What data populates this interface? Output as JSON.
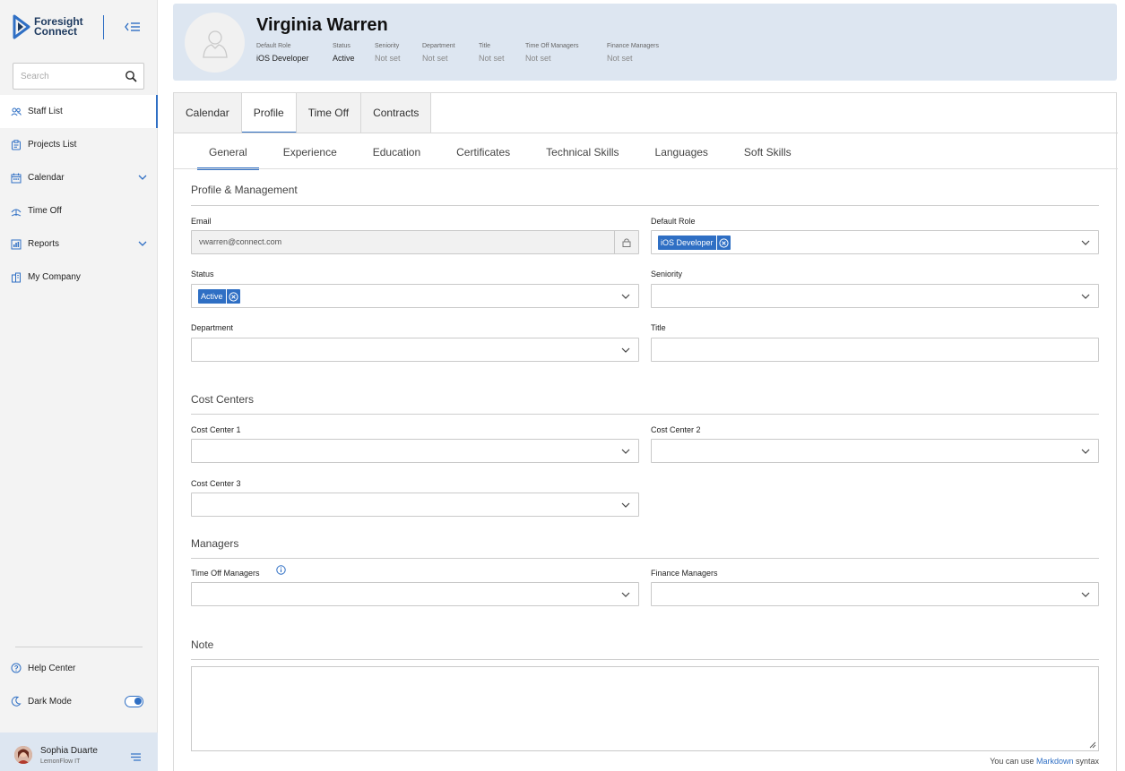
{
  "app": {
    "logo_line1": "Foresight",
    "logo_line2": "Connect",
    "brand_color": "#2f6fc4"
  },
  "search": {
    "placeholder": "Search"
  },
  "sidebar": {
    "items": [
      {
        "label": "Staff List",
        "icon": "people-icon",
        "active": true
      },
      {
        "label": "Projects List",
        "icon": "clipboard-icon"
      },
      {
        "label": "Calendar",
        "icon": "calendar-icon",
        "expandable": true
      },
      {
        "label": "Time Off",
        "icon": "timeoff-icon"
      },
      {
        "label": "Reports",
        "icon": "report-icon",
        "expandable": true
      },
      {
        "label": "My Company",
        "icon": "building-icon"
      }
    ],
    "help": "Help Center",
    "dark_mode": "Dark Mode",
    "dark_mode_on": true
  },
  "user": {
    "name": "Sophia Duarte",
    "org": "LemonFlow IT"
  },
  "profile": {
    "name": "Virginia Warren",
    "meta": [
      {
        "label": "Default Role",
        "value": "iOS Developer"
      },
      {
        "label": "Status",
        "value": "Active"
      },
      {
        "label": "Seniority",
        "value": "Not set"
      },
      {
        "label": "Department",
        "value": "Not set"
      },
      {
        "label": "Title",
        "value": "Not set"
      },
      {
        "label": "Time Off Managers",
        "value": "Not set"
      },
      {
        "label": "Finance Managers",
        "value": "Not set"
      }
    ]
  },
  "tabs": [
    "Calendar",
    "Profile",
    "Time Off",
    "Contracts"
  ],
  "subtabs": [
    "General",
    "Experience",
    "Education",
    "Certificates",
    "Technical Skills",
    "Languages",
    "Soft Skills"
  ],
  "form": {
    "section_profile": "Profile & Management",
    "email_label": "Email",
    "email_value": "vwarren@connect.com",
    "default_role_label": "Default Role",
    "default_role_value": "iOS Developer",
    "status_label": "Status",
    "status_value": "Active",
    "seniority_label": "Seniority",
    "department_label": "Department",
    "title_label": "Title",
    "section_cost": "Cost Centers",
    "cc1_label": "Cost Center 1",
    "cc2_label": "Cost Center 2",
    "cc3_label": "Cost Center 3",
    "section_managers": "Managers",
    "time_off_managers_label": "Time Off Managers",
    "finance_managers_label": "Finance Managers",
    "section_note": "Note",
    "md_hint_pre": "You can use",
    "md_hint_link": "Markdown",
    "md_hint_post": "syntax"
  }
}
